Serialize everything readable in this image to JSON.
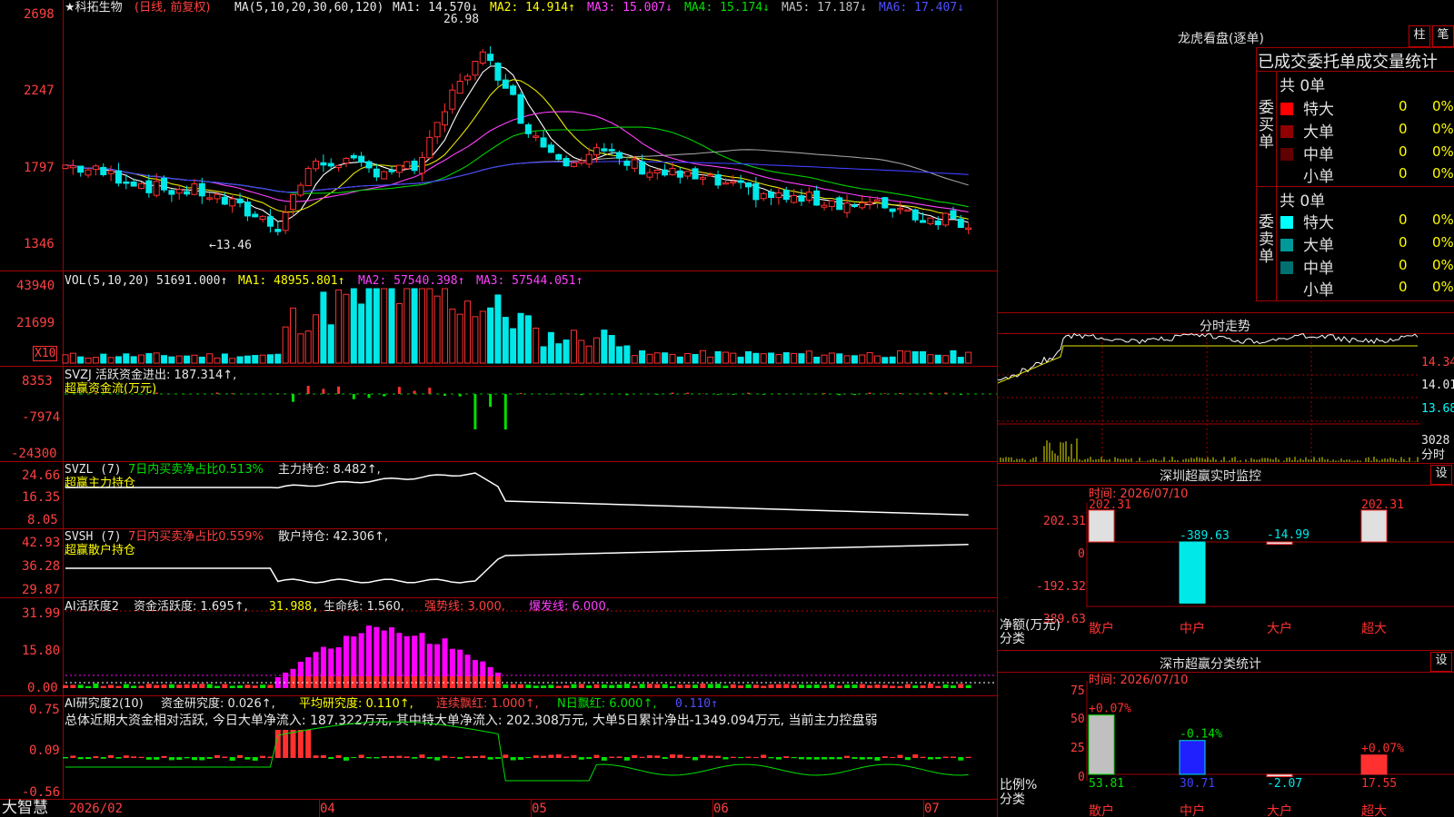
{
  "colors": {
    "up": "#ff3030",
    "down": "#00e8e8",
    "ma1": "#ffffff",
    "ma2": "#e6e600",
    "ma3": "#ff40ff",
    "ma4": "#00d000",
    "ma5": "#a0a0a0",
    "ma6": "#4040ff"
  },
  "main": {
    "stock_name": "★科拓生物",
    "period_label": "(日线, 前复权)",
    "ma_params": "MA(5,10,20,30,60,120)",
    "ma1": "MA1: 14.570↓",
    "ma2": "MA2: 14.914↑",
    "ma3": "MA3: 15.007↓",
    "ma4": "MA4: 15.174↓",
    "ma5": "MA5: 17.187↓",
    "ma6": "MA6: 17.407↓",
    "y_labels": [
      "2698",
      "2247",
      "1797",
      "1346"
    ],
    "high_marker": "26.98",
    "low_marker": "←13.46"
  },
  "vol": {
    "header": "VOL(5,10,20)",
    "val": "51691.000↑",
    "ma1": "MA1: 48955.801↑",
    "ma2": "MA2: 57540.398↑",
    "ma3": "MA3: 57544.051↑",
    "y_labels": [
      "43940",
      "21699"
    ],
    "multiplier": "X10"
  },
  "svzj": {
    "header": "SVZJ  活跃资金进出: 187.314↑,",
    "sub": "超赢资金流(万元)",
    "y_labels": [
      "8353",
      "-7974",
      "-24300"
    ]
  },
  "svzl": {
    "header_a": "SVZL (7)",
    "header_b": "7日内买卖净占比0.513%",
    "header_c": "主力持仓: 8.482↑,",
    "sub": "超赢主力持仓",
    "y_labels": [
      "24.66",
      "16.35",
      "8.05"
    ]
  },
  "svsh": {
    "header_a": "SVSH (7)",
    "header_b": "7日内买卖净占比0.559%",
    "header_c": "散户持仓: 42.306↑,",
    "sub": "超赢散户持仓",
    "y_labels": [
      "42.93",
      "36.28",
      "29.87"
    ]
  },
  "ai_active": {
    "header_a": "AI活跃度2",
    "header_b": "资金活跃度: 1.695↑,",
    "header_c": "31.988,",
    "header_d": "生命线: 1.560,",
    "header_e": "强势线: 3.000,",
    "header_f": "爆发线: 6.000,",
    "y_labels": [
      "31.99",
      "15.80",
      "0.00"
    ]
  },
  "ai_research": {
    "header_a": "AI研究度2(10)",
    "header_b": "资金研究度: 0.026↑,",
    "header_c": "平均研究度: 0.110↑,",
    "header_d": "连续飘红: 1.000↑,",
    "header_e": "N日飘红: 6.000↑,",
    "header_f": "0.110↑",
    "summary": "总体近期大资金相对活跃, 今日大单净流入: 187.322万元, 其中特大单净流入: 202.308万元, 大单5日累计净出-1349.094万元, 当前主力控盘弱",
    "y_labels": [
      "0.75",
      "0.09",
      "-0.56"
    ]
  },
  "xaxis": {
    "brand": "大智慧",
    "labels": [
      "2026/02",
      "04",
      "05",
      "06",
      "07"
    ]
  },
  "dragon": {
    "title": "龙虎看盘(逐单)",
    "btn_column": "柱",
    "btn_pen": "笔",
    "tabs": "已成交委托单成交量统计",
    "buy_total": "共 0单",
    "sell_total": "共 0单",
    "buy_label": "委买单",
    "sell_label": "委卖单",
    "rows": [
      {
        "name": "特大",
        "count": "0",
        "pct": "0%"
      },
      {
        "name": "大单",
        "count": "0",
        "pct": "0%"
      },
      {
        "name": "中单",
        "count": "0",
        "pct": "0%"
      },
      {
        "name": "小单",
        "count": "0",
        "pct": "0%"
      }
    ]
  },
  "intraday": {
    "title": "分时走势",
    "y_labels": [
      "14.34",
      "14.01",
      "13.68"
    ],
    "vol_label": "3028",
    "sub_label": "分时"
  },
  "monitor": {
    "title": "深圳超赢实时监控",
    "settings": "设",
    "time": "时间: 2026/07/10",
    "y_labels": [
      "202.31",
      "0",
      "-192.32",
      "-389.63"
    ],
    "axis_title": "净额(万元)",
    "axis_title2": "分类",
    "bars": [
      {
        "name": "散户",
        "value": 202.31,
        "label": "202.31"
      },
      {
        "name": "中户",
        "value": -389.63,
        "label": "-389.63"
      },
      {
        "name": "大户",
        "value": -14.99,
        "label": "-14.99"
      },
      {
        "name": "超大",
        "value": 202.31,
        "label": "202.31"
      }
    ]
  },
  "classify": {
    "title": "深市超赢分类统计",
    "settings": "设",
    "time": "时间: 2026/07/10",
    "y_labels": [
      "75",
      "50",
      "25",
      "0"
    ],
    "axis_title": "比例%",
    "axis_title2": "分类",
    "bars": [
      {
        "name": "散户",
        "value": 53.81,
        "label": "53.81",
        "delta": "+0.07%"
      },
      {
        "name": "中户",
        "value": 30.71,
        "label": "30.71",
        "delta": "-0.14%"
      },
      {
        "name": "大户",
        "value": -2.07,
        "label": "-2.07",
        "delta": ""
      },
      {
        "name": "超大",
        "value": 17.55,
        "label": "17.55",
        "delta": "+0.07%"
      }
    ]
  }
}
